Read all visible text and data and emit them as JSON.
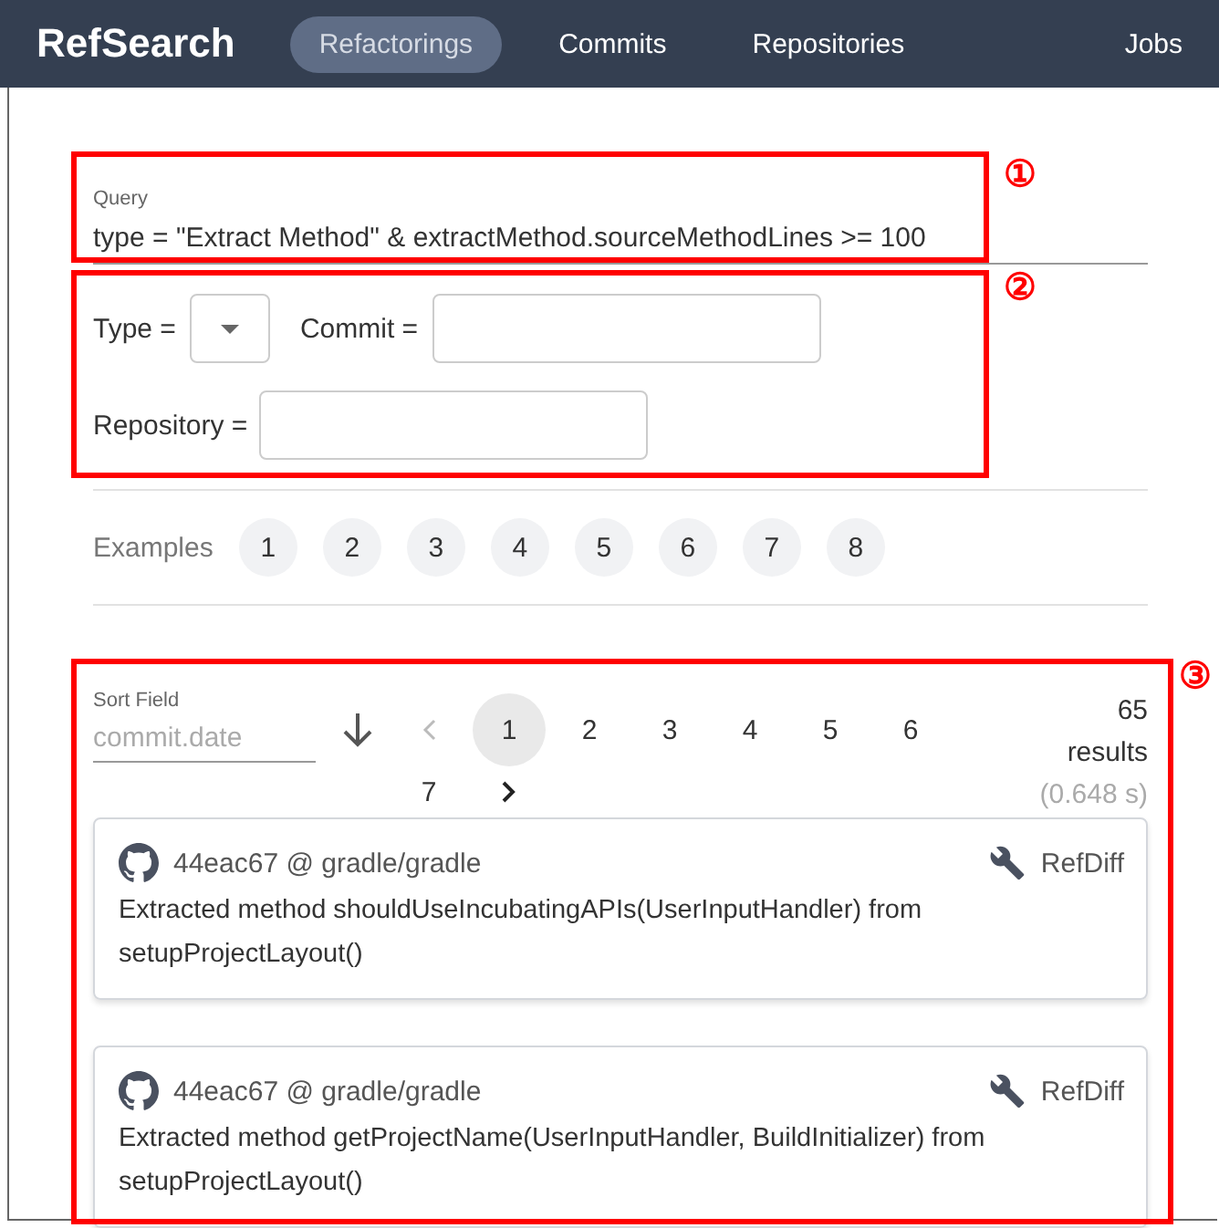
{
  "nav": {
    "brand": "RefSearch",
    "tabs": [
      {
        "label": "Refactorings",
        "selected": true
      },
      {
        "label": "Commits",
        "selected": false
      },
      {
        "label": "Repositories",
        "selected": false
      },
      {
        "label": "Jobs",
        "selected": false
      }
    ]
  },
  "annotations": [
    "①",
    "②",
    "③"
  ],
  "query": {
    "label": "Query",
    "value": "type = \"Extract Method\" & extractMethod.sourceMethodLines >= 100"
  },
  "filters": {
    "type_label": "Type =",
    "commit_label": "Commit =",
    "repository_label": "Repository ="
  },
  "examples": {
    "label": "Examples",
    "buttons": [
      "1",
      "2",
      "3",
      "4",
      "5",
      "6",
      "7",
      "8"
    ]
  },
  "results": {
    "sort_label": "Sort Field",
    "sort_placeholder": "commit.date",
    "previous": {
      "disabled": true
    },
    "next": {
      "disabled": false
    },
    "pages": [
      {
        "label": "1",
        "selected": true
      },
      {
        "label": "2",
        "selected": false
      },
      {
        "label": "3",
        "selected": false
      },
      {
        "label": "4",
        "selected": false
      },
      {
        "label": "5",
        "selected": false
      },
      {
        "label": "6",
        "selected": false
      },
      {
        "label": "7",
        "selected": false
      }
    ],
    "count": "65",
    "count_unit": "results",
    "time": "(0.648 s)",
    "items": [
      {
        "commit": "44eac67 @ gradle/gradle",
        "tool": "RefDiff",
        "description": "Extracted method shouldUseIncubatingAPIs(UserInputHandler) from setupProjectLayout()"
      },
      {
        "commit": "44eac67 @ gradle/gradle",
        "tool": "RefDiff",
        "description": "Extracted method getProjectName(UserInputHandler, BuildInitializer) from setupProjectLayout()"
      }
    ]
  }
}
